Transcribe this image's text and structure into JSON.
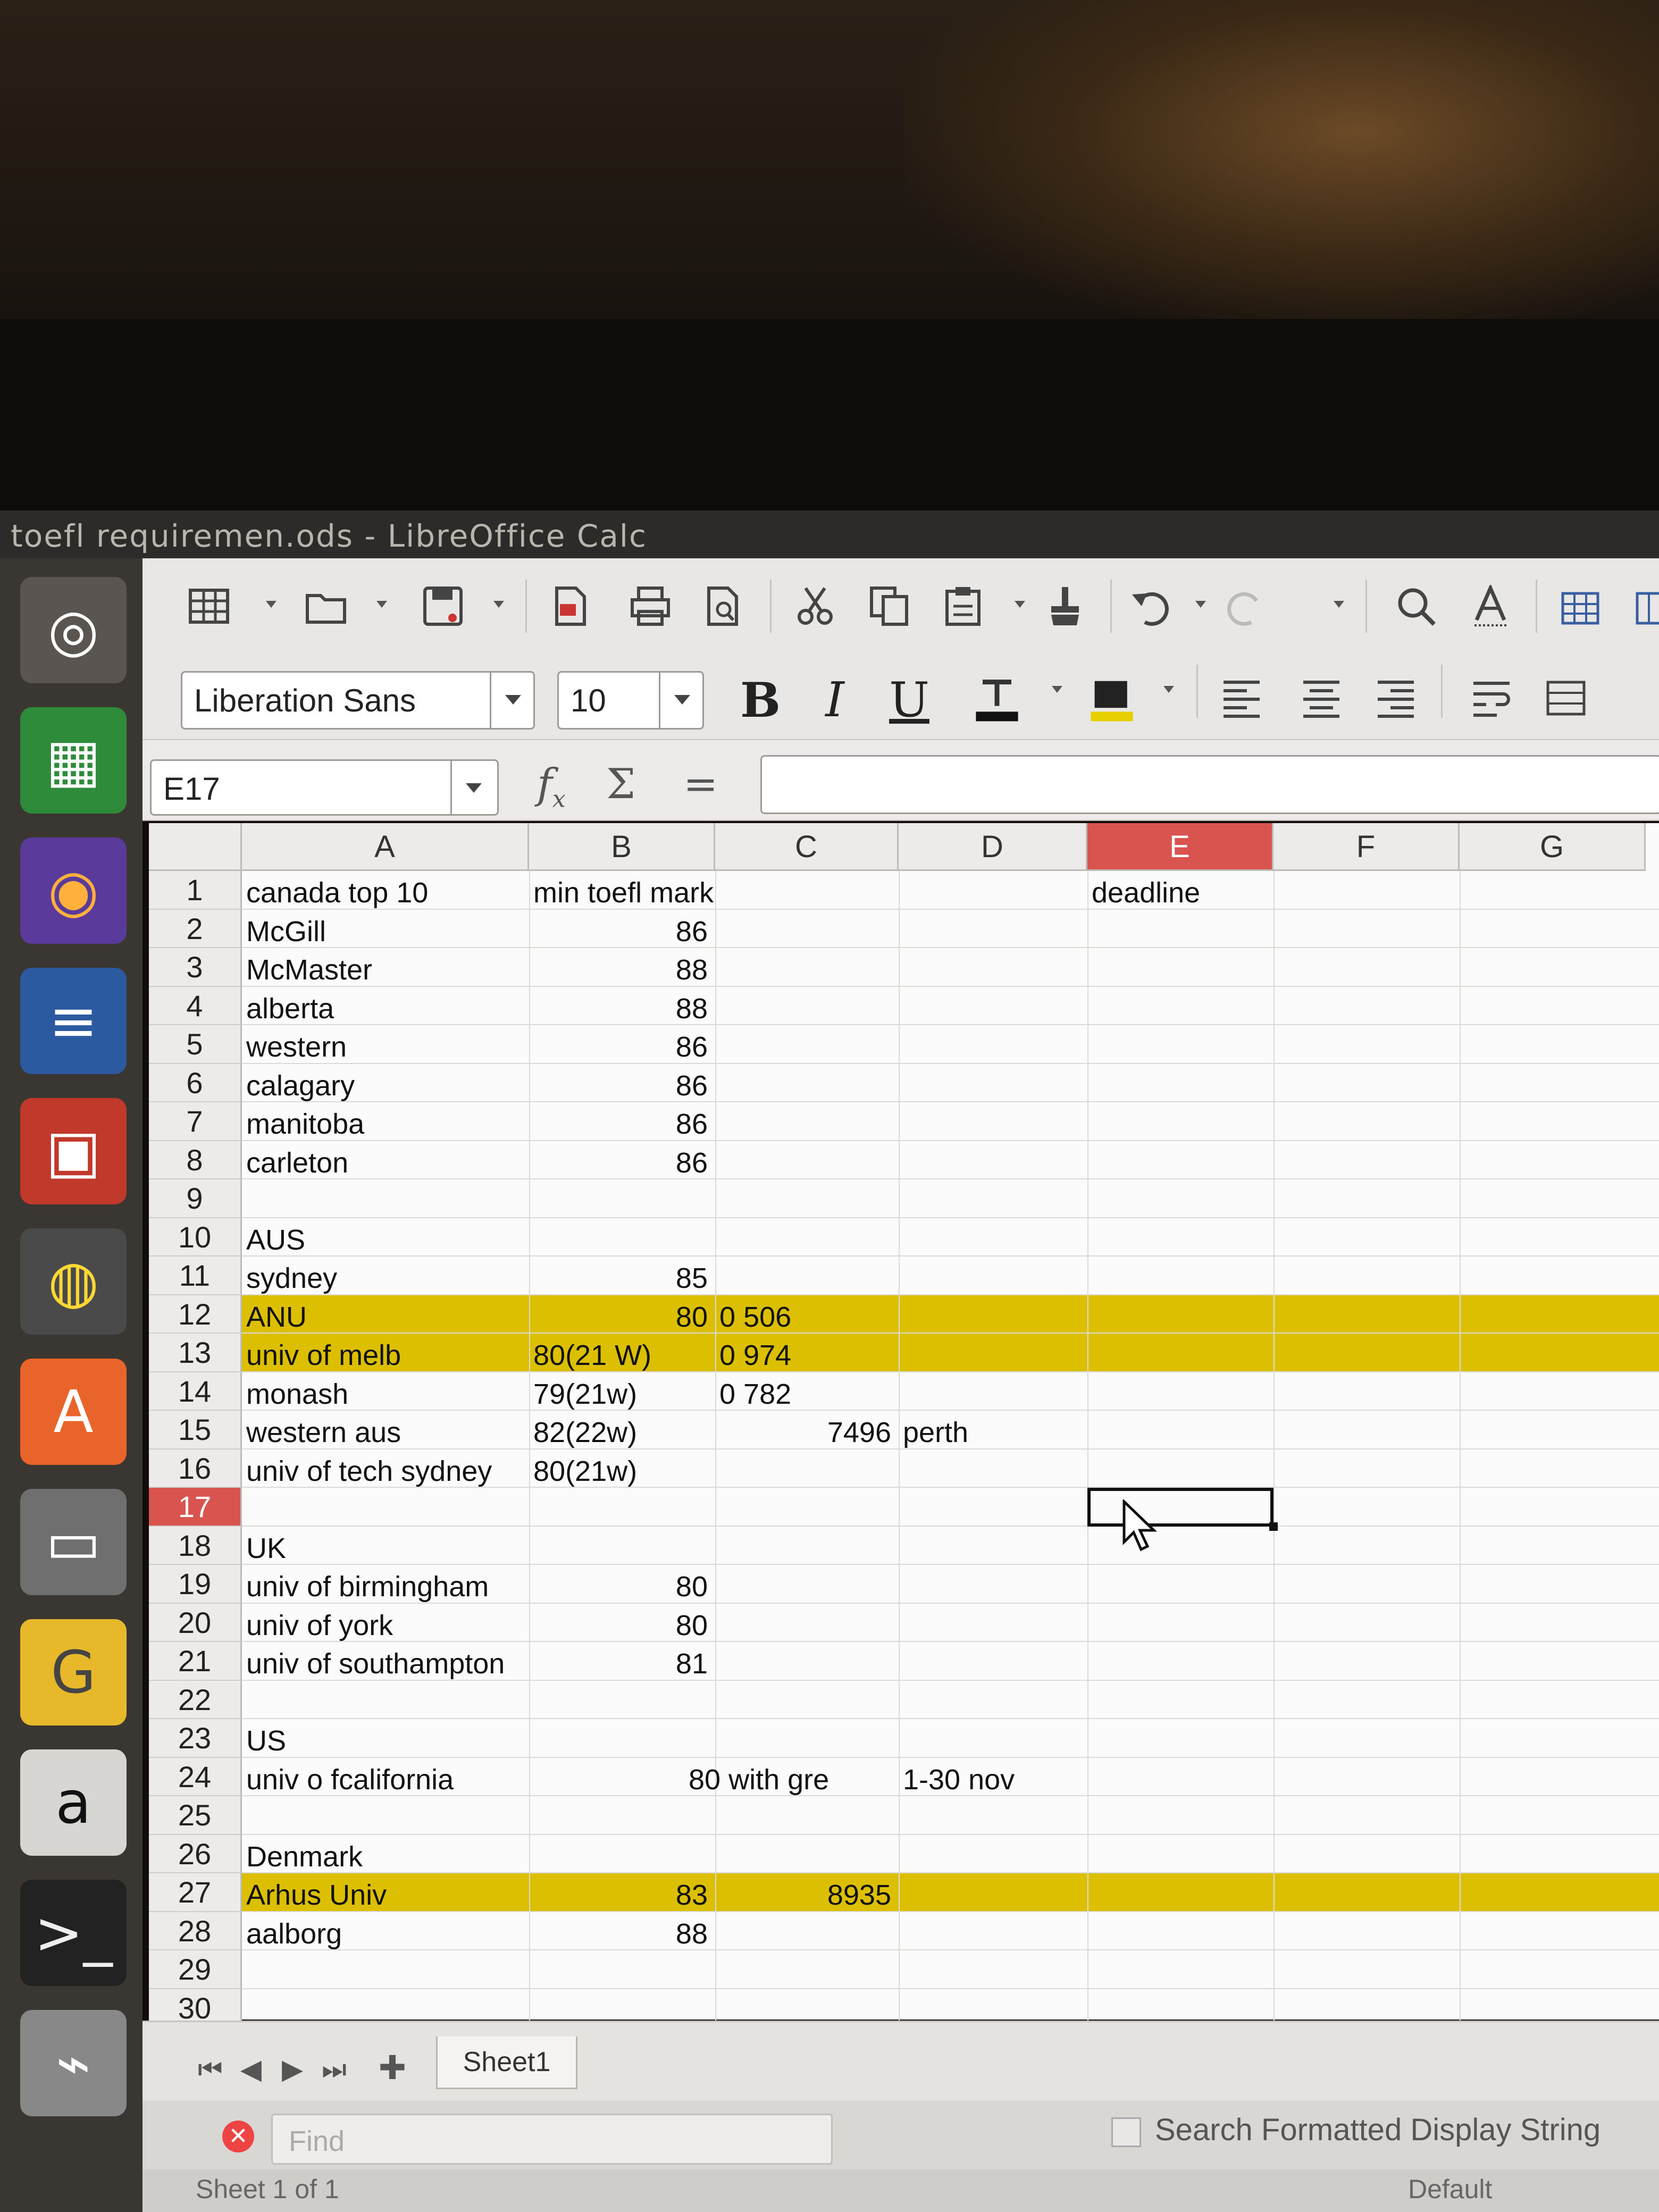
{
  "window": {
    "title": "toefl requiremen.ods - LibreOffice Calc"
  },
  "launcher": {
    "apps": [
      {
        "name": "ubuntu-dash-icon"
      },
      {
        "name": "calc-app-icon"
      },
      {
        "name": "firefox-icon"
      },
      {
        "name": "writer-app-icon"
      },
      {
        "name": "impress-app-icon"
      },
      {
        "name": "chrome-icon"
      },
      {
        "name": "software-center-icon"
      },
      {
        "name": "files-icon"
      },
      {
        "name": "app-icon-g"
      },
      {
        "name": "amazon-icon"
      },
      {
        "name": "terminal-icon"
      },
      {
        "name": "app-icon-misc"
      }
    ]
  },
  "formatting": {
    "font_name": "Liberation Sans",
    "font_size": "10"
  },
  "formula_bar": {
    "name_box": "E17",
    "formula": ""
  },
  "sheet": {
    "columns": [
      "A",
      "B",
      "C",
      "D",
      "E",
      "F",
      "G"
    ],
    "selected_column": "E",
    "selected_row": "17",
    "rows": [
      {
        "n": "1",
        "a": "canada top 10",
        "b": "min toefl mark",
        "b_align": "left",
        "c": "",
        "d": "",
        "e": "deadline"
      },
      {
        "n": "2",
        "a": "McGill",
        "b": "86",
        "b_align": "right"
      },
      {
        "n": "3",
        "a": "McMaster",
        "b": "88",
        "b_align": "right"
      },
      {
        "n": "4",
        "a": "alberta",
        "b": "88",
        "b_align": "right"
      },
      {
        "n": "5",
        "a": "western",
        "b": "86",
        "b_align": "right"
      },
      {
        "n": "6",
        "a": "calagary",
        "b": "86",
        "b_align": "right"
      },
      {
        "n": "7",
        "a": "manitoba",
        "b": "86",
        "b_align": "right"
      },
      {
        "n": "8",
        "a": "carleton",
        "b": "86",
        "b_align": "right"
      },
      {
        "n": "9",
        "a": ""
      },
      {
        "n": "10",
        "a": "AUS"
      },
      {
        "n": "11",
        "a": "sydney",
        "b": "85",
        "b_align": "right"
      },
      {
        "n": "12",
        "a": "ANU",
        "b": "80",
        "b_align": "right",
        "c": "0 506",
        "hl": true
      },
      {
        "n": "13",
        "a": "univ of melb",
        "b": "80(21 W)",
        "b_align": "left",
        "c": "0 974",
        "hl": true
      },
      {
        "n": "14",
        "a": "monash",
        "b": "79(21w)",
        "b_align": "left",
        "c": "0 782"
      },
      {
        "n": "15",
        "a": "western aus",
        "b": "82(22w)",
        "b_align": "left",
        "c_right": "7496",
        "d": "perth"
      },
      {
        "n": "16",
        "a": "univ of tech sydney",
        "b": "80(21w)",
        "b_align": "left"
      },
      {
        "n": "17",
        "a": ""
      },
      {
        "n": "18",
        "a": "UK"
      },
      {
        "n": "19",
        "a": "univ of birmingham",
        "b": "80",
        "b_align": "right"
      },
      {
        "n": "20",
        "a": "univ of york",
        "b": "80",
        "b_align": "right"
      },
      {
        "n": "21",
        "a": "univ of southampton",
        "b": "81",
        "b_align": "right"
      },
      {
        "n": "22",
        "a": ""
      },
      {
        "n": "23",
        "a": "US"
      },
      {
        "n": "24",
        "a": "univ o fcalifornia",
        "b": "80 with gre",
        "b_align": "right-overflow",
        "d": "1-30 nov"
      },
      {
        "n": "25",
        "a": ""
      },
      {
        "n": "26",
        "a": "Denmark"
      },
      {
        "n": "27",
        "a": "Arhus Univ",
        "b": "83",
        "b_align": "right",
        "c_right": "8935",
        "hl": true
      },
      {
        "n": "28",
        "a": "aalborg",
        "b": "88",
        "b_align": "right"
      },
      {
        "n": "29",
        "a": ""
      },
      {
        "n": "30",
        "a": ""
      }
    ]
  },
  "tabs": {
    "sheet_name": "Sheet1"
  },
  "find": {
    "placeholder": "Find",
    "option": "Search Formatted Display String"
  },
  "status": {
    "sheet_info": "Sheet 1 of 1",
    "style": "Default"
  },
  "colors": {
    "highlight": "#dcc000",
    "selection": "#d9534f"
  }
}
